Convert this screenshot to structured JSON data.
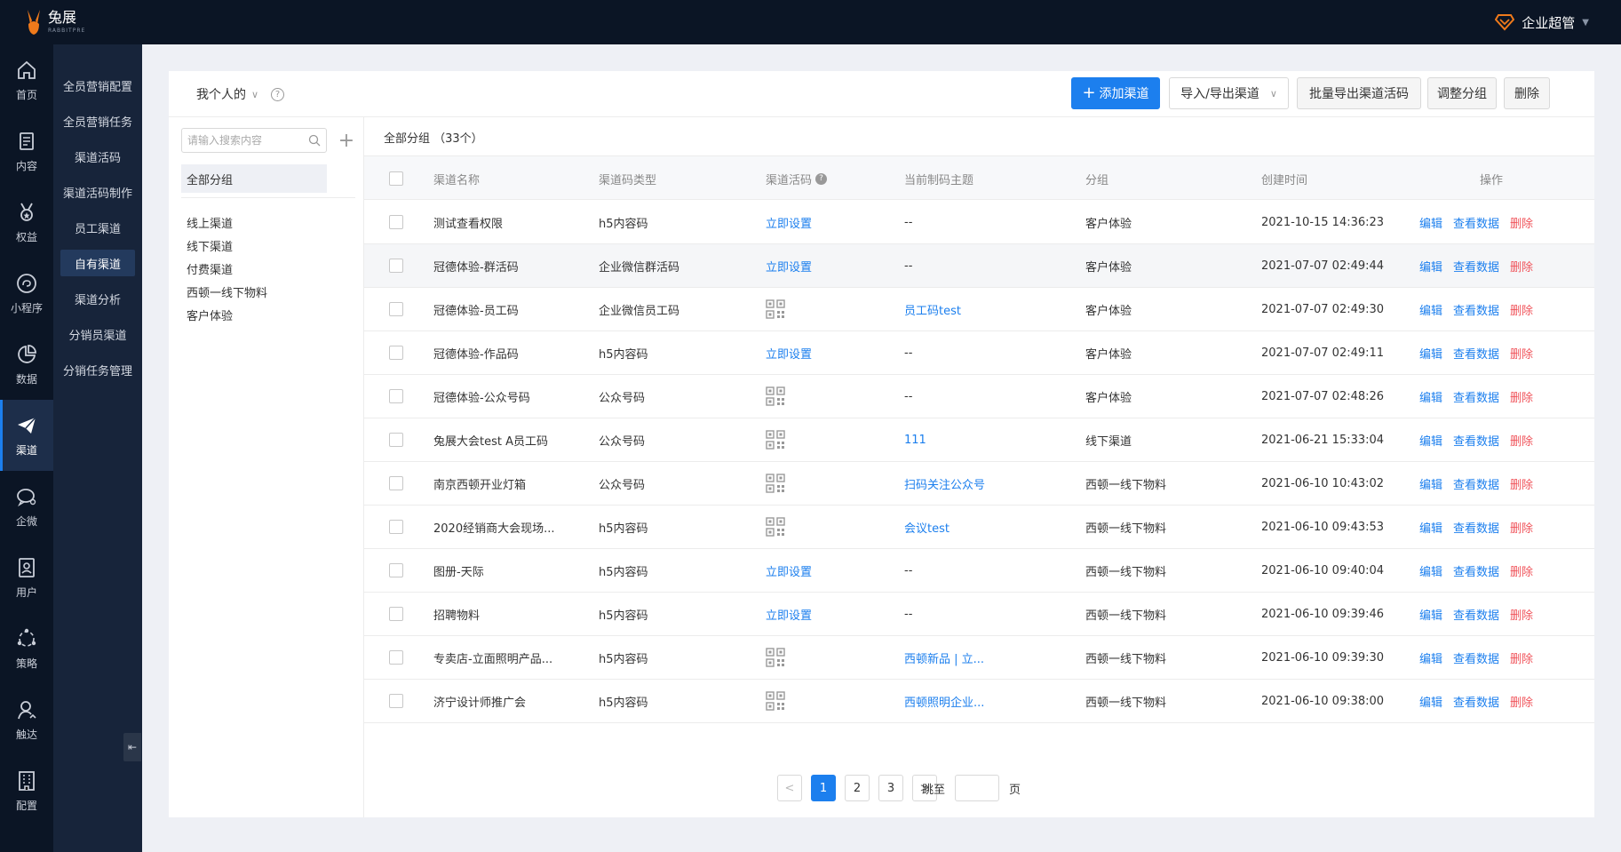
{
  "brand": {
    "name": "兔展",
    "sub": "RABBITPRE",
    "accent": "#f07a1b"
  },
  "user": {
    "name": "企业超管",
    "icon": "diamond-icon"
  },
  "nav": {
    "icon_items": [
      {
        "label": "首页",
        "icon": "home-icon"
      },
      {
        "label": "内容",
        "icon": "document-icon"
      },
      {
        "label": "权益",
        "icon": "medal-icon"
      },
      {
        "label": "小程序",
        "icon": "link-icon"
      },
      {
        "label": "数据",
        "icon": "pie-chart-icon"
      },
      {
        "label": "渠道",
        "icon": "send-icon"
      },
      {
        "label": "企微",
        "icon": "chat-icon"
      },
      {
        "label": "用户",
        "icon": "user-card-icon"
      },
      {
        "label": "策略",
        "icon": "strategy-icon"
      },
      {
        "label": "触达",
        "icon": "reach-icon"
      },
      {
        "label": "配置",
        "icon": "building-icon"
      }
    ],
    "sub_items": [
      "全员营销配置",
      "全员营销任务",
      "渠道活码",
      "渠道活码制作",
      "员工渠道",
      "自有渠道",
      "渠道分析",
      "分销员渠道",
      "分销任务管理"
    ]
  },
  "toolbar": {
    "scope_label": "我个人的",
    "add_channel": "添加渠道",
    "import_export": "导入/导出渠道",
    "batch_export": "批量导出渠道活码",
    "adjust_group": "调整分组",
    "delete": "删除"
  },
  "groups": {
    "search_placeholder": "请输入搜索内容",
    "all_label": "全部分组",
    "items": [
      "线上渠道",
      "线下渠道",
      "付费渠道",
      "西顿一线下物料",
      "客户体验"
    ]
  },
  "table": {
    "title": "全部分组 （33个）",
    "columns": [
      "渠道名称",
      "渠道码类型",
      "渠道活码",
      "当前制码主题",
      "分组",
      "创建时间",
      "操作"
    ],
    "set_now": "立即设置",
    "actions": {
      "edit": "编辑",
      "view": "查看数据",
      "delete": "删除"
    },
    "rows": [
      {
        "name": "测试查看权限",
        "type": "h5内容码",
        "code": "setup",
        "theme": "--",
        "theme_link": false,
        "group": "客户体验",
        "created": "2021-10-15 14:36:23"
      },
      {
        "name": "冠德体验-群活码",
        "type": "企业微信群活码",
        "code": "setup",
        "theme": "--",
        "theme_link": false,
        "group": "客户体验",
        "created": "2021-07-07 02:49:44"
      },
      {
        "name": "冠德体验-员工码",
        "type": "企业微信员工码",
        "code": "qr",
        "theme": "员工码test",
        "theme_link": true,
        "group": "客户体验",
        "created": "2021-07-07 02:49:30"
      },
      {
        "name": "冠德体验-作品码",
        "type": "h5内容码",
        "code": "setup",
        "theme": "--",
        "theme_link": false,
        "group": "客户体验",
        "created": "2021-07-07 02:49:11"
      },
      {
        "name": "冠德体验-公众号码",
        "type": "公众号码",
        "code": "qr",
        "theme": "--",
        "theme_link": false,
        "group": "客户体验",
        "created": "2021-07-07 02:48:26"
      },
      {
        "name": "兔展大会test A员工码",
        "type": "公众号码",
        "code": "qr",
        "theme": "111",
        "theme_link": true,
        "group": "线下渠道",
        "created": "2021-06-21 15:33:04"
      },
      {
        "name": "南京西顿开业灯箱",
        "type": "公众号码",
        "code": "qr",
        "theme": "扫码关注公众号",
        "theme_link": true,
        "group": "西顿一线下物料",
        "created": "2021-06-10 10:43:02"
      },
      {
        "name": "2020经销商大会现场...",
        "type": "h5内容码",
        "code": "qr",
        "theme": "会议test",
        "theme_link": true,
        "group": "西顿一线下物料",
        "created": "2021-06-10 09:43:53"
      },
      {
        "name": "图册-天际",
        "type": "h5内容码",
        "code": "setup",
        "theme": "--",
        "theme_link": false,
        "group": "西顿一线下物料",
        "created": "2021-06-10 09:40:04"
      },
      {
        "name": "招聘物料",
        "type": "h5内容码",
        "code": "setup",
        "theme": "--",
        "theme_link": false,
        "group": "西顿一线下物料",
        "created": "2021-06-10 09:39:46"
      },
      {
        "name": "专卖店-立面照明产品...",
        "type": "h5内容码",
        "code": "qr",
        "theme": "西顿新品 | 立...",
        "theme_link": true,
        "group": "西顿一线下物料",
        "created": "2021-06-10 09:39:30"
      },
      {
        "name": "济宁设计师推广会",
        "type": "h5内容码",
        "code": "qr",
        "theme": "西顿照明企业...",
        "theme_link": true,
        "group": "西顿一线下物料",
        "created": "2021-06-10 09:38:00"
      }
    ]
  },
  "pagination": {
    "pages": [
      "1",
      "2",
      "3"
    ],
    "current": "1",
    "prev": "<",
    "next": ">",
    "jump_label": "跳至",
    "page_suffix": "页"
  }
}
